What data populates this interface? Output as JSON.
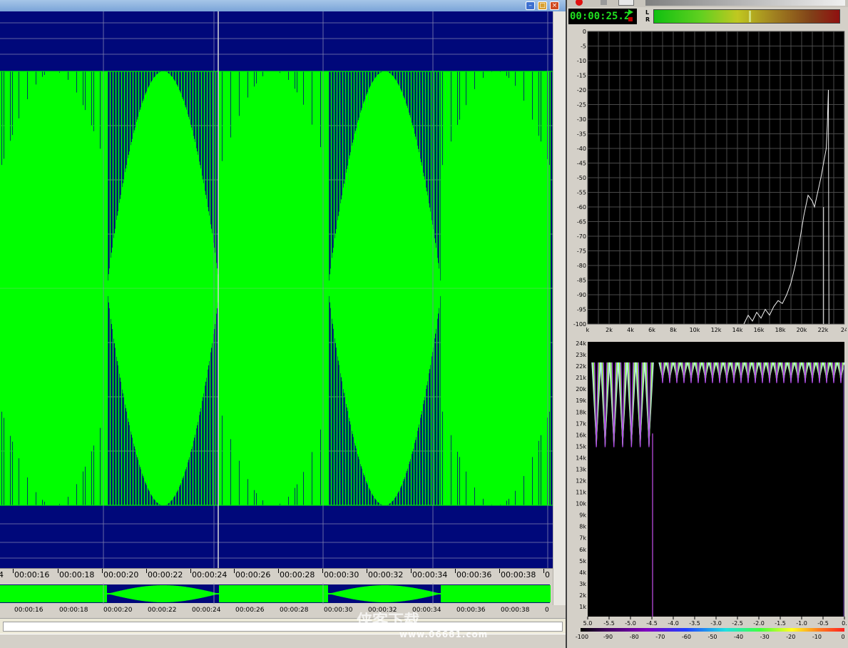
{
  "editor": {
    "window_buttons": {
      "minimize": "–",
      "maximize": "□",
      "close": "×"
    },
    "colors": {
      "background": "#00087a",
      "waveform": "#00ff00",
      "grid": "#8080b0",
      "cursor": "#d8d8d8"
    },
    "timeline_labels": [
      "4",
      "00:00:16",
      "00:00:18",
      "00:00:20",
      "00:00:22",
      "00:00:24",
      "00:00:26",
      "00:00:28",
      "00:00:30",
      "00:00:32",
      "00:00:34",
      "00:00:36",
      "00:00:38",
      "0"
    ],
    "overview_labels": [
      "00:00:16",
      "00:00:18",
      "00:00:20",
      "00:00:22",
      "00:00:24",
      "00:00:26",
      "00:00:28",
      "00:00:30",
      "00:00:32",
      "00:00:34",
      "00:00:36",
      "00:00:38",
      "0"
    ],
    "watermark": "侠客下载",
    "watermark_site": "www.06681.com"
  },
  "panel": {
    "time": "00:00:25.2",
    "channels": [
      "L",
      "R"
    ],
    "level_fraction": 0.53,
    "spectrum": {
      "y_labels": [
        "0",
        "-5",
        "-10",
        "-15",
        "-20",
        "-25",
        "-30",
        "-35",
        "-40",
        "-45",
        "-50",
        "-55",
        "-60",
        "-65",
        "-70",
        "-75",
        "-80",
        "-85",
        "-90",
        "-95",
        "-100"
      ],
      "x_labels": [
        "k",
        "2k",
        "4k",
        "6k",
        "8k",
        "10k",
        "12k",
        "14k",
        "16k",
        "18k",
        "20k",
        "22k",
        "24"
      ]
    },
    "spectrogram": {
      "y_labels": [
        "24k",
        "23k",
        "22k",
        "21k",
        "20k",
        "19k",
        "18k",
        "17k",
        "16k",
        "15k",
        "14k",
        "13k",
        "12k",
        "11k",
        "10k",
        "9k",
        "8k",
        "7k",
        "6k",
        "5k",
        "4k",
        "3k",
        "2k",
        "1k"
      ],
      "x_labels": [
        "5.0",
        "-5.5",
        "-5.0",
        "-4.5",
        "-4.0",
        "-3.5",
        "-3.0",
        "-2.5",
        "-2.0",
        "-1.5",
        "-1.0",
        "-0.5",
        "0."
      ],
      "scale_labels": [
        "-100",
        "-90",
        "-80",
        "-70",
        "-60",
        "-50",
        "-40",
        "-30",
        "-20",
        "-10",
        "0"
      ]
    }
  }
}
